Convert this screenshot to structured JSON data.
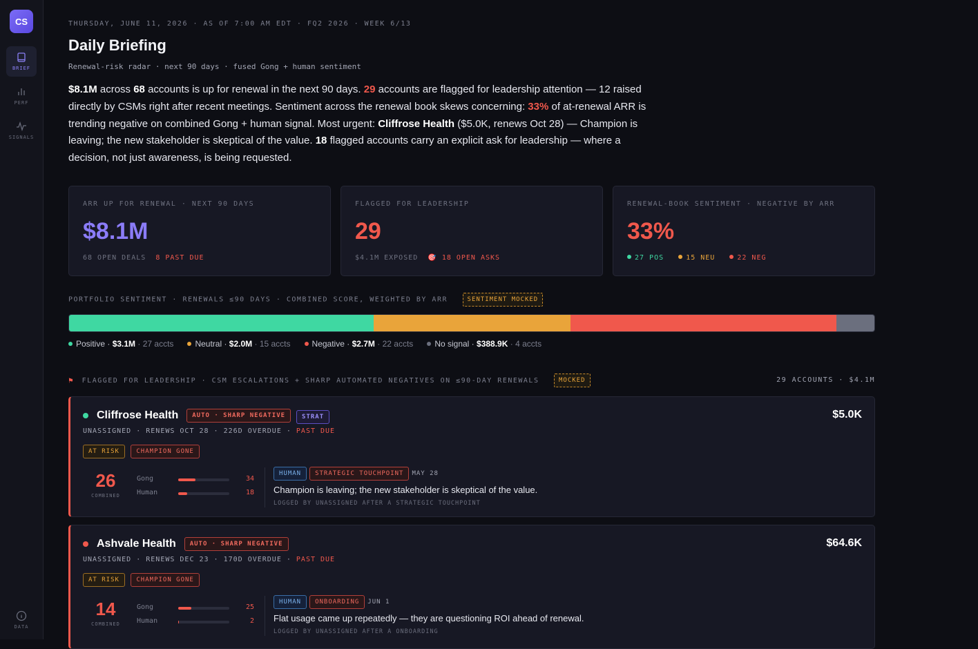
{
  "sidebar": {
    "logo": "CS",
    "items": [
      {
        "label": "BRIEF",
        "icon": "book-icon"
      },
      {
        "label": "PERF",
        "icon": "bar-chart-icon"
      },
      {
        "label": "SIGNALS",
        "icon": "pulse-icon"
      }
    ],
    "footer": {
      "label": "DATA",
      "icon": "info-icon"
    }
  },
  "header": {
    "eyebrow": "THURSDAY, JUNE 11, 2026 · AS OF 7:00 AM EDT · FQ2 2026 · WEEK 6/13",
    "title": "Daily Briefing",
    "subtitle": "Renewal-risk radar · next 90 days · fused Gong + human sentiment"
  },
  "summary": {
    "arr": "$8.1M",
    "t1": " across ",
    "accounts": "68",
    "t2": " accounts is up for renewal in the next 90 days. ",
    "flagged": "29",
    "t3": " accounts are flagged for leadership attention — 12 raised directly by CSMs right after recent meetings. Sentiment across the renewal book skews concerning: ",
    "neg_pct": "33%",
    "t4": " of at-renewal ARR is trending negative on combined Gong + human signal. Most urgent: ",
    "urgent": "Cliffrose Health",
    "t5": " ($5.0K, renews Oct 28) — Champion is leaving; the new stakeholder is skeptical of the value. ",
    "asks": "18",
    "t6": " flagged accounts carry an explicit ask for leadership — where a decision, not just awareness, is being requested."
  },
  "kpis": {
    "arr": {
      "label": "ARR UP FOR RENEWAL · NEXT 90 DAYS",
      "value": "$8.1M",
      "sub1": "68 OPEN DEALS",
      "sub2": "8 PAST DUE"
    },
    "flagged": {
      "label": "FLAGGED FOR LEADERSHIP",
      "value": "29",
      "sub1": "$4.1M EXPOSED",
      "sub2": "18 OPEN ASKS",
      "icon": "target-icon"
    },
    "sentiment": {
      "label": "RENEWAL-BOOK SENTIMENT · NEGATIVE BY ARR",
      "value": "33%",
      "pos": "27 POS",
      "neu": "15 NEU",
      "neg": "22 NEG"
    }
  },
  "portfolio": {
    "label": "PORTFOLIO SENTIMENT · RENEWALS ≤90 DAYS · COMBINED SCORE, WEIGHTED BY ARR",
    "badge": "SENTIMENT MOCKED",
    "segments": [
      {
        "name": "Positive ·",
        "amount": "$3.1M",
        "count": "· 27 accts",
        "value": 3.1,
        "color": "#3fd8a2"
      },
      {
        "name": "Neutral ·",
        "amount": "$2.0M",
        "count": "· 15 accts",
        "value": 2.0,
        "color": "#e9a43a"
      },
      {
        "name": "Negative ·",
        "amount": "$2.7M",
        "count": "· 22 accts",
        "value": 2.7,
        "color": "#f0584c"
      },
      {
        "name": "No signal ·",
        "amount": "$388.9K",
        "count": "· 4 accts",
        "value": 0.3889,
        "color": "#6b6f7e"
      }
    ]
  },
  "flagged": {
    "label": "FLAGGED FOR LEADERSHIP · CSM ESCALATIONS + SHARP AUTOMATED NEGATIVES ON ≤90-DAY RENEWALS",
    "badge": "MOCKED",
    "summary": "29 ACCOUNTS · $4.1M",
    "accounts": [
      {
        "name": "Cliffrose Health",
        "dot_color": "#3fd8a2",
        "tag": "AUTO · SHARP NEGATIVE",
        "tier": "STRAT",
        "amount": "$5.0K",
        "meta": "UNASSIGNED · RENEWS OCT 28 · 226D OVERDUE · ",
        "past_due": "PAST DUE",
        "risk": "AT RISK",
        "reason": "CHAMPION GONE",
        "combined": "26",
        "combined_label": "COMBINED",
        "gong_label": "Gong",
        "gong": 34,
        "human_label": "Human",
        "human": 18,
        "source": "HUMAN",
        "touchpoint": "STRATEGIC TOUCHPOINT",
        "date": "MAY 28",
        "quote": "Champion is leaving; the new stakeholder is skeptical of the value.",
        "by": "LOGGED BY UNASSIGNED AFTER A STRATEGIC TOUCHPOINT"
      },
      {
        "name": "Ashvale Health",
        "dot_color": "#f0584c",
        "tag": "AUTO · SHARP NEGATIVE",
        "amount": "$64.6K",
        "meta": "UNASSIGNED · RENEWS DEC 23 · 170D OVERDUE · ",
        "past_due": "PAST DUE",
        "risk": "AT RISK",
        "reason": "CHAMPION GONE",
        "combined": "14",
        "combined_label": "COMBINED",
        "gong_label": "Gong",
        "gong": 25,
        "human_label": "Human",
        "human": 2,
        "source": "HUMAN",
        "touchpoint": "ONBOARDING",
        "date": "JUN 1",
        "quote": "Flat usage came up repeatedly — they are questioning ROI ahead of renewal.",
        "by": "LOGGED BY UNASSIGNED AFTER A ONBOARDING"
      }
    ]
  }
}
